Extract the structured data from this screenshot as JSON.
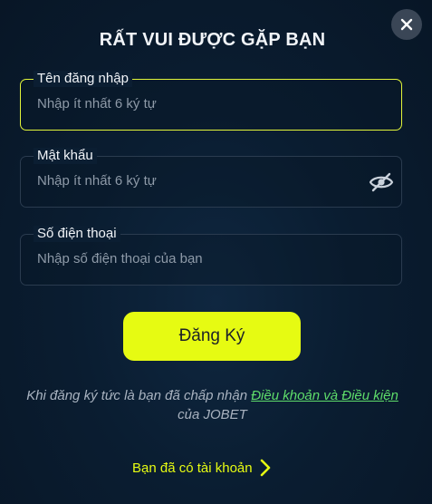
{
  "dialog": {
    "title": "RẤT VUI ĐƯỢC GẶP BẠN",
    "close_icon": "close-icon"
  },
  "fields": {
    "username": {
      "label": "Tên đăng nhập",
      "placeholder": "Nhập ít nhất 6 ký tự",
      "value": ""
    },
    "password": {
      "label": "Mật khẩu",
      "placeholder": "Nhập ít nhất 6 ký tự",
      "value": "",
      "toggle_icon": "eye-off-icon"
    },
    "phone": {
      "label": "Số điện thoại",
      "placeholder": "Nhập số điện thoại của bạn",
      "value": ""
    }
  },
  "register_button": {
    "label": "Đăng Ký"
  },
  "terms": {
    "prefix": "Khi đăng ký tức là bạn đã chấp nhận ",
    "link": "Điều khoản và Điều kiện",
    "suffix": "của JOBET"
  },
  "login_link": {
    "label": "Bạn đã có tài khoản",
    "icon": "chevron-right-icon"
  },
  "colors": {
    "accent": "#e6fb12",
    "link": "#5edc6a",
    "background": "#0a1d31"
  }
}
